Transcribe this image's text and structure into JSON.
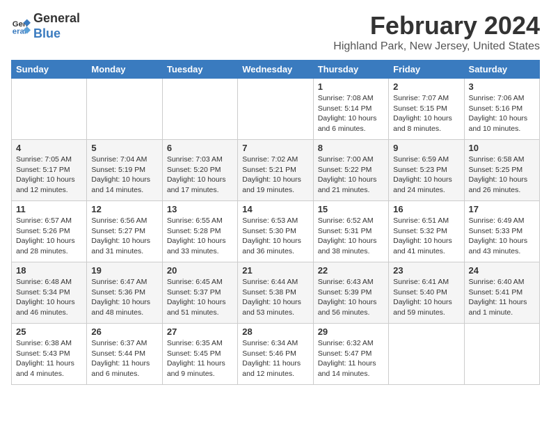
{
  "header": {
    "logo_general": "General",
    "logo_blue": "Blue",
    "title": "February 2024",
    "subtitle": "Highland Park, New Jersey, United States"
  },
  "days_of_week": [
    "Sunday",
    "Monday",
    "Tuesday",
    "Wednesday",
    "Thursday",
    "Friday",
    "Saturday"
  ],
  "weeks": [
    [
      {
        "day": "",
        "info": ""
      },
      {
        "day": "",
        "info": ""
      },
      {
        "day": "",
        "info": ""
      },
      {
        "day": "",
        "info": ""
      },
      {
        "day": "1",
        "info": "Sunrise: 7:08 AM\nSunset: 5:14 PM\nDaylight: 10 hours\nand 6 minutes."
      },
      {
        "day": "2",
        "info": "Sunrise: 7:07 AM\nSunset: 5:15 PM\nDaylight: 10 hours\nand 8 minutes."
      },
      {
        "day": "3",
        "info": "Sunrise: 7:06 AM\nSunset: 5:16 PM\nDaylight: 10 hours\nand 10 minutes."
      }
    ],
    [
      {
        "day": "4",
        "info": "Sunrise: 7:05 AM\nSunset: 5:17 PM\nDaylight: 10 hours\nand 12 minutes."
      },
      {
        "day": "5",
        "info": "Sunrise: 7:04 AM\nSunset: 5:19 PM\nDaylight: 10 hours\nand 14 minutes."
      },
      {
        "day": "6",
        "info": "Sunrise: 7:03 AM\nSunset: 5:20 PM\nDaylight: 10 hours\nand 17 minutes."
      },
      {
        "day": "7",
        "info": "Sunrise: 7:02 AM\nSunset: 5:21 PM\nDaylight: 10 hours\nand 19 minutes."
      },
      {
        "day": "8",
        "info": "Sunrise: 7:00 AM\nSunset: 5:22 PM\nDaylight: 10 hours\nand 21 minutes."
      },
      {
        "day": "9",
        "info": "Sunrise: 6:59 AM\nSunset: 5:23 PM\nDaylight: 10 hours\nand 24 minutes."
      },
      {
        "day": "10",
        "info": "Sunrise: 6:58 AM\nSunset: 5:25 PM\nDaylight: 10 hours\nand 26 minutes."
      }
    ],
    [
      {
        "day": "11",
        "info": "Sunrise: 6:57 AM\nSunset: 5:26 PM\nDaylight: 10 hours\nand 28 minutes."
      },
      {
        "day": "12",
        "info": "Sunrise: 6:56 AM\nSunset: 5:27 PM\nDaylight: 10 hours\nand 31 minutes."
      },
      {
        "day": "13",
        "info": "Sunrise: 6:55 AM\nSunset: 5:28 PM\nDaylight: 10 hours\nand 33 minutes."
      },
      {
        "day": "14",
        "info": "Sunrise: 6:53 AM\nSunset: 5:30 PM\nDaylight: 10 hours\nand 36 minutes."
      },
      {
        "day": "15",
        "info": "Sunrise: 6:52 AM\nSunset: 5:31 PM\nDaylight: 10 hours\nand 38 minutes."
      },
      {
        "day": "16",
        "info": "Sunrise: 6:51 AM\nSunset: 5:32 PM\nDaylight: 10 hours\nand 41 minutes."
      },
      {
        "day": "17",
        "info": "Sunrise: 6:49 AM\nSunset: 5:33 PM\nDaylight: 10 hours\nand 43 minutes."
      }
    ],
    [
      {
        "day": "18",
        "info": "Sunrise: 6:48 AM\nSunset: 5:34 PM\nDaylight: 10 hours\nand 46 minutes."
      },
      {
        "day": "19",
        "info": "Sunrise: 6:47 AM\nSunset: 5:36 PM\nDaylight: 10 hours\nand 48 minutes."
      },
      {
        "day": "20",
        "info": "Sunrise: 6:45 AM\nSunset: 5:37 PM\nDaylight: 10 hours\nand 51 minutes."
      },
      {
        "day": "21",
        "info": "Sunrise: 6:44 AM\nSunset: 5:38 PM\nDaylight: 10 hours\nand 53 minutes."
      },
      {
        "day": "22",
        "info": "Sunrise: 6:43 AM\nSunset: 5:39 PM\nDaylight: 10 hours\nand 56 minutes."
      },
      {
        "day": "23",
        "info": "Sunrise: 6:41 AM\nSunset: 5:40 PM\nDaylight: 10 hours\nand 59 minutes."
      },
      {
        "day": "24",
        "info": "Sunrise: 6:40 AM\nSunset: 5:41 PM\nDaylight: 11 hours\nand 1 minute."
      }
    ],
    [
      {
        "day": "25",
        "info": "Sunrise: 6:38 AM\nSunset: 5:43 PM\nDaylight: 11 hours\nand 4 minutes."
      },
      {
        "day": "26",
        "info": "Sunrise: 6:37 AM\nSunset: 5:44 PM\nDaylight: 11 hours\nand 6 minutes."
      },
      {
        "day": "27",
        "info": "Sunrise: 6:35 AM\nSunset: 5:45 PM\nDaylight: 11 hours\nand 9 minutes."
      },
      {
        "day": "28",
        "info": "Sunrise: 6:34 AM\nSunset: 5:46 PM\nDaylight: 11 hours\nand 12 minutes."
      },
      {
        "day": "29",
        "info": "Sunrise: 6:32 AM\nSunset: 5:47 PM\nDaylight: 11 hours\nand 14 minutes."
      },
      {
        "day": "",
        "info": ""
      },
      {
        "day": "",
        "info": ""
      }
    ]
  ]
}
